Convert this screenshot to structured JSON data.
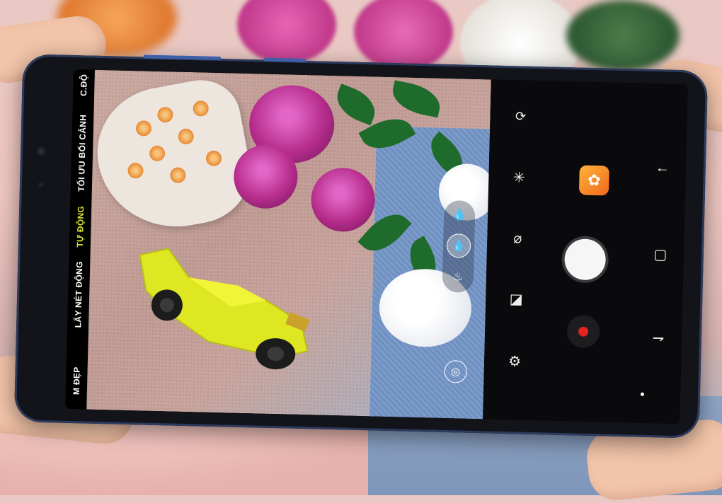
{
  "camera": {
    "modes": [
      "C.ĐỘ",
      "TỐI ƯU BỐI CẢNH",
      "TỰ ĐỘNG",
      "LẤY NÉT ĐỘNG",
      "M ĐẸP"
    ],
    "active_mode": "TỰ ĐỘNG",
    "colors": {
      "active_mode": "#d8e831",
      "bixby": "#f58b2a",
      "record": "#e32222"
    }
  },
  "icons": {
    "switch_camera": "switch-camera-icon",
    "flash": "flash-off-icon",
    "timer": "timer-icon",
    "aspect": "aspect-ratio-icon",
    "settings": "gear-icon",
    "bixby": "bixby-vision-icon",
    "back": "back-arrow-icon",
    "recent": "recent-apps-icon",
    "home_swap": "nav-swap-icon"
  }
}
